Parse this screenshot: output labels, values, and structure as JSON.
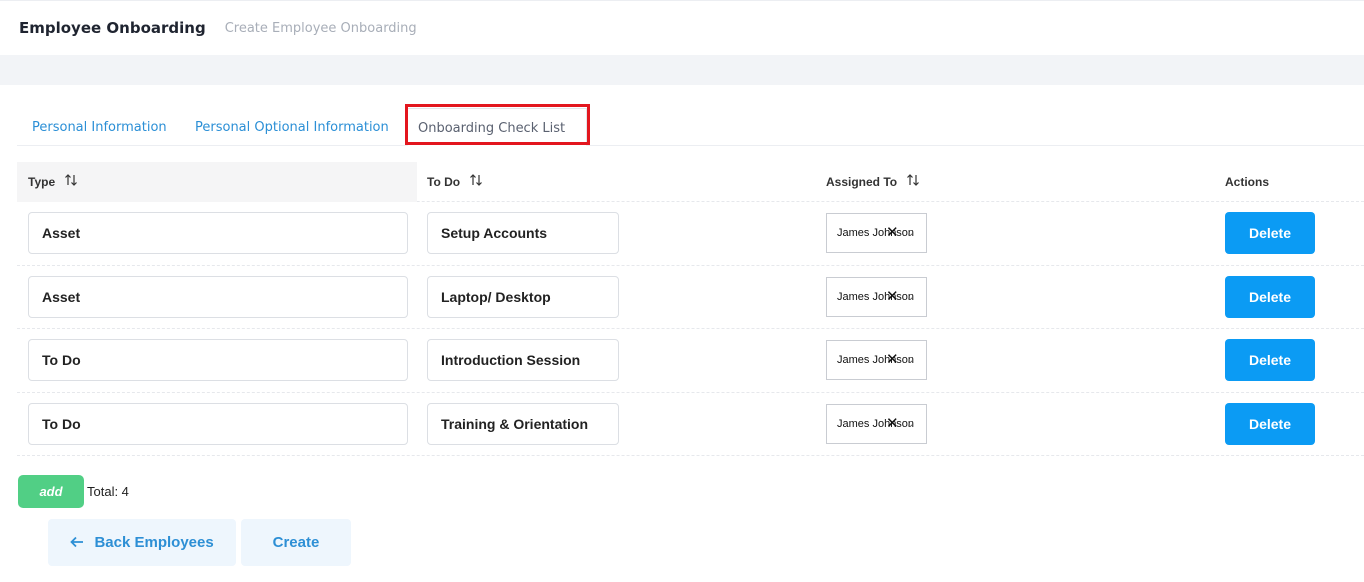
{
  "header": {
    "title": "Employee Onboarding",
    "breadcrumb": "Create Employee Onboarding"
  },
  "tabs": [
    {
      "label": "Personal Information",
      "active": false
    },
    {
      "label": "Personal Optional Information",
      "active": false
    },
    {
      "label": "Onboarding Check List",
      "active": true
    }
  ],
  "table": {
    "headers": {
      "type": "Type",
      "todo": "To Do",
      "assigned": "Assigned To",
      "actions": "Actions"
    },
    "rows": [
      {
        "type": "Asset",
        "todo": "Setup Accounts",
        "assigned": "James Johnson",
        "action": "Delete"
      },
      {
        "type": "Asset",
        "todo": "Laptop/ Desktop",
        "assigned": "James Johnson",
        "action": "Delete"
      },
      {
        "type": "To Do",
        "todo": "Introduction Session",
        "assigned": "James Johnson",
        "action": "Delete"
      },
      {
        "type": "To Do",
        "todo": "Training & Orientation",
        "assigned": "James Johnson",
        "action": "Delete"
      }
    ]
  },
  "footer": {
    "add_label": "add",
    "total_label": "Total: 4",
    "back_label": "Back Employees",
    "create_label": "Create"
  },
  "icons": {
    "sort": "sort-arrows-icon",
    "clear": "close-icon",
    "dropdown": "chevron-down-icon",
    "back": "arrow-left-icon"
  },
  "colors": {
    "accent": "#0b9bf4",
    "add": "#51cf85",
    "tab_link": "#2b8fd6",
    "highlight": "#e3161e"
  }
}
